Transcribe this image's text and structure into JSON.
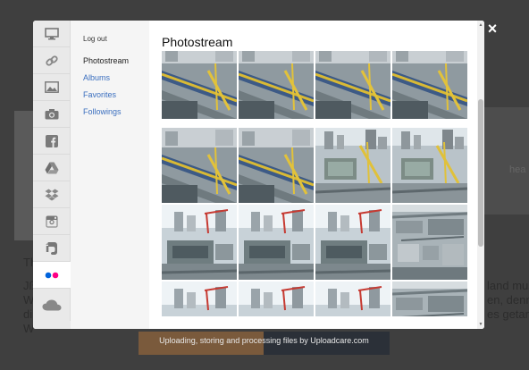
{
  "modal": {
    "title": "Photostream",
    "logout": "Log out",
    "nav": [
      "Photostream",
      "Albums",
      "Favorites",
      "Followings"
    ],
    "services": [
      "computer-icon",
      "link-icon",
      "image-icon",
      "camera-icon",
      "facebook-icon",
      "drive-icon",
      "dropbox-icon",
      "instagram-icon",
      "evernote-icon",
      "flickr-icon",
      "cloud-icon"
    ]
  },
  "close_label": "×",
  "footer": "Uploading, storing and processing files by Uploadcare.com",
  "background": {
    "line1": "Th",
    "line2": "Jß",
    "line3": "W",
    "line4": "di",
    "line5": "W",
    "right1": "land mus",
    "right2": "en, denn",
    "right3": "es getan",
    "right_card": "hea"
  },
  "colors": {
    "link": "#3b6fbf",
    "flickr_blue": "#0063dc",
    "flickr_pink": "#ff0084"
  },
  "photos": [
    [
      "construction-rail",
      "construction-rail",
      "construction-rail",
      "construction-rail"
    ],
    [
      "construction-rail",
      "construction-rail",
      "city-site",
      "city-site"
    ],
    [
      "city-crane",
      "city-crane",
      "city-crane",
      "site-overview"
    ],
    [
      "city-crane",
      "city-crane",
      "city-crane",
      "site-overview"
    ]
  ]
}
